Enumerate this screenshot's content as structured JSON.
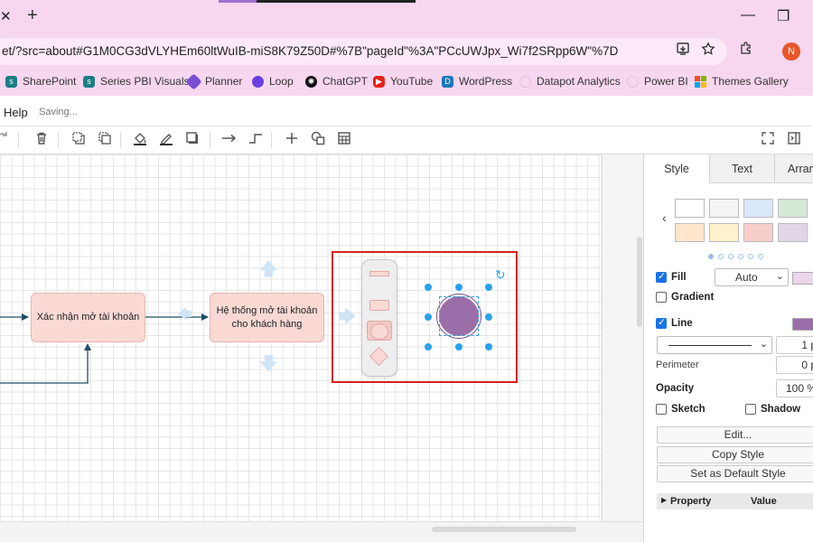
{
  "browser": {
    "tab_close": "✕",
    "tab_new": "+",
    "url": "et/?src=about#G1M0CG3dVLYHEm60ltWuIB-miS8K79Z50D#%7B\"pageId\"%3A\"PCcUWJpx_Wi7f2SRpp6W\"%7D",
    "profile_initial": "N",
    "window_minimize": "—",
    "window_restore": "❐"
  },
  "bookmarks": [
    {
      "label": "SharePoint",
      "icon": "sharepoint-icon",
      "color": "#1b7f84"
    },
    {
      "label": "Series PBI Visuals",
      "icon": "sharepoint-icon",
      "color": "#1b7f84"
    },
    {
      "label": "Planner",
      "icon": "planner-icon",
      "color": "#7b4fd6"
    },
    {
      "label": "Loop",
      "icon": "loop-icon",
      "color": "#6a3fe0"
    },
    {
      "label": "ChatGPT",
      "icon": "chatgpt-icon",
      "color": "#111111"
    },
    {
      "label": "YouTube",
      "icon": "youtube-icon",
      "color": "#e62117"
    },
    {
      "label": "WordPress",
      "icon": "wordpress-icon",
      "color": "#1c76bb"
    },
    {
      "label": "Datapot Analytics",
      "icon": "globe-icon",
      "color": "#f0f0f0"
    },
    {
      "label": "Power BI",
      "icon": "globe-icon",
      "color": "#f0f0f0"
    },
    {
      "label": "Themes Gallery",
      "icon": "microsoft-icon",
      "color": "#f25022"
    }
  ],
  "menu": {
    "help": "Help",
    "status": "Saving..."
  },
  "diagram": {
    "node1": "Xác nhận mở tài khoản",
    "node2": "Hệ thống mở tài khoản cho khách hàng"
  },
  "panel": {
    "tabs": [
      "Style",
      "Text",
      "Arran"
    ],
    "fill_label": "Fill",
    "fill_mode": "Auto",
    "gradient_label": "Gradient",
    "line_label": "Line",
    "line_width": "1 p",
    "perimeter_label": "Perimeter",
    "perimeter_value": "0 p",
    "opacity_label": "Opacity",
    "opacity_value": "100 %",
    "sketch_label": "Sketch",
    "shadow_label": "Shadow",
    "edit_button": "Edit...",
    "copy_style_button": "Copy Style",
    "default_style_button": "Set as Default Style",
    "property_header": "Property",
    "value_header": "Value"
  },
  "colors": {
    "fill_chip": "#e9d6ea",
    "line_chip": "#9a6ea8",
    "swatches": [
      "#ffffff",
      "#f5f5f5",
      "#dae8fc",
      "#d5e8d4",
      "#ffe6cc",
      "#fff2cc",
      "#f8cecc",
      "#e1d5e7"
    ]
  }
}
